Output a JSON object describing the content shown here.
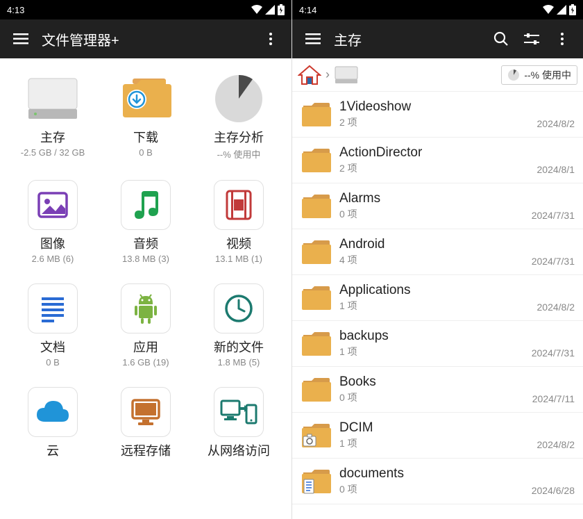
{
  "left": {
    "statusTime": "4:13",
    "title": "文件管理器+",
    "items": [
      {
        "label": "主存",
        "sub": "-2.5 GB / 32 GB",
        "icon": "drive"
      },
      {
        "label": "下载",
        "sub": "0 B",
        "icon": "download"
      },
      {
        "label": "主存分析",
        "sub": "--% 使用中",
        "icon": "pie"
      },
      {
        "label": "图像",
        "sub": "2.6 MB (6)",
        "icon": "image",
        "card": true
      },
      {
        "label": "音频",
        "sub": "13.8 MB (3)",
        "icon": "music",
        "card": true
      },
      {
        "label": "视频",
        "sub": "13.1 MB (1)",
        "icon": "video",
        "card": true
      },
      {
        "label": "文档",
        "sub": "0 B",
        "icon": "doc",
        "card": true
      },
      {
        "label": "应用",
        "sub": "1.6 GB (19)",
        "icon": "apk",
        "card": true
      },
      {
        "label": "新的文件",
        "sub": "1.8 MB (5)",
        "icon": "clock",
        "card": true
      },
      {
        "label": "云",
        "sub": "",
        "icon": "cloud",
        "card": true
      },
      {
        "label": "远程存储",
        "sub": "",
        "icon": "monitor",
        "card": true
      },
      {
        "label": "从网络访问",
        "sub": "",
        "icon": "transfer",
        "card": true
      }
    ]
  },
  "right": {
    "statusTime": "4:14",
    "title": "主存",
    "usageLabel": "--% 使用中",
    "rows": [
      {
        "name": "1Videoshow",
        "count": "2 项",
        "date": "2024/8/2",
        "type": "folder"
      },
      {
        "name": "ActionDirector",
        "count": "2 项",
        "date": "2024/8/1",
        "type": "folder"
      },
      {
        "name": "Alarms",
        "count": "0 项",
        "date": "2024/7/31",
        "type": "folder"
      },
      {
        "name": "Android",
        "count": "4 项",
        "date": "2024/7/31",
        "type": "folder"
      },
      {
        "name": "Applications",
        "count": "1 项",
        "date": "2024/8/2",
        "type": "folder"
      },
      {
        "name": "backups",
        "count": "1 项",
        "date": "2024/7/31",
        "type": "folder"
      },
      {
        "name": "Books",
        "count": "0 项",
        "date": "2024/7/11",
        "type": "folder"
      },
      {
        "name": "DCIM",
        "count": "1 项",
        "date": "2024/8/2",
        "type": "dcim"
      },
      {
        "name": "documents",
        "count": "0 项",
        "date": "2024/6/28",
        "type": "documents"
      }
    ]
  }
}
